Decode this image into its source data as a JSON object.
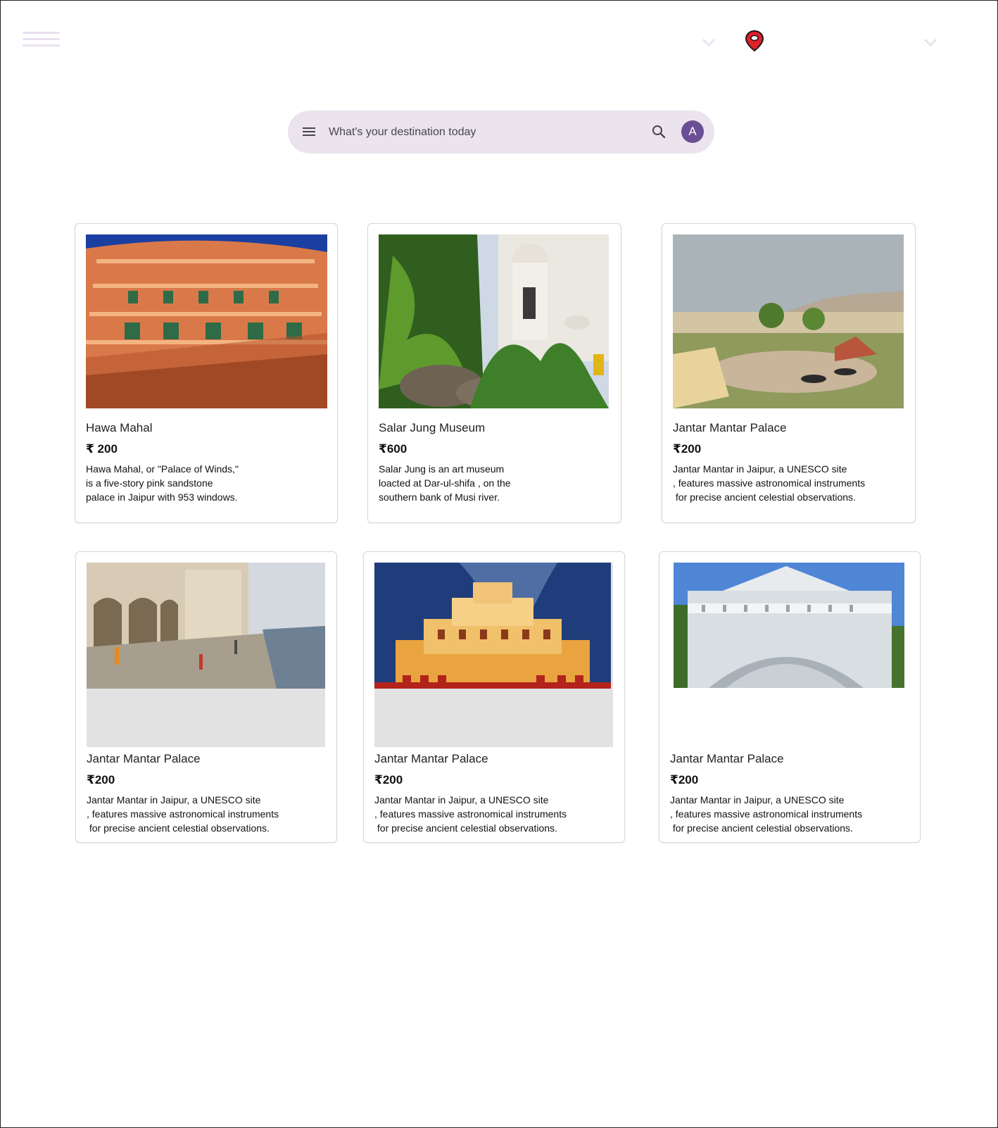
{
  "search": {
    "placeholder": "What's your destination today",
    "avatar_letter": "A"
  },
  "header": {
    "menu_icon": "hamburger-icon",
    "location_icon": "map-pin-icon",
    "dropdown_icon": "chevron-down-icon"
  },
  "colors": {
    "search_bg": "#ebe4ef",
    "avatar_bg": "#6a4f94",
    "pin_red": "#e0202a",
    "muted_lavender": "#e9e1ef"
  },
  "cards": [
    {
      "title": "Hawa Mahal",
      "price": "₹ 200",
      "desc": "Hawa Mahal, or \"Palace of Winds,\"\nis a five-story pink sandstone\npalace in Jaipur with 953 windows."
    },
    {
      "title": "Salar Jung Museum",
      "price": "₹600",
      "desc": "Salar Jung is an art museum\nloacted at Dar-ul-shifa , on the\nsouthern bank of Musi river."
    },
    {
      "title": "Jantar Mantar Palace",
      "price": "₹200",
      "desc": "Jantar Mantar in Jaipur, a UNESCO site\n, features massive astronomical instruments\n for precise ancient celestial observations."
    },
    {
      "title": "Jantar Mantar Palace",
      "price": "₹200",
      "desc": "Jantar Mantar in Jaipur, a UNESCO site\n, features massive astronomical instruments\n for precise ancient celestial observations."
    },
    {
      "title": "Jantar Mantar Palace",
      "price": "₹200",
      "desc": "Jantar Mantar in Jaipur, a UNESCO site\n, features massive astronomical instruments\n for precise ancient celestial observations."
    },
    {
      "title": "Jantar Mantar Palace",
      "price": "₹200",
      "desc": "Jantar Mantar in Jaipur, a UNESCO site\n, features massive astronomical instruments\n for precise ancient celestial observations."
    }
  ]
}
